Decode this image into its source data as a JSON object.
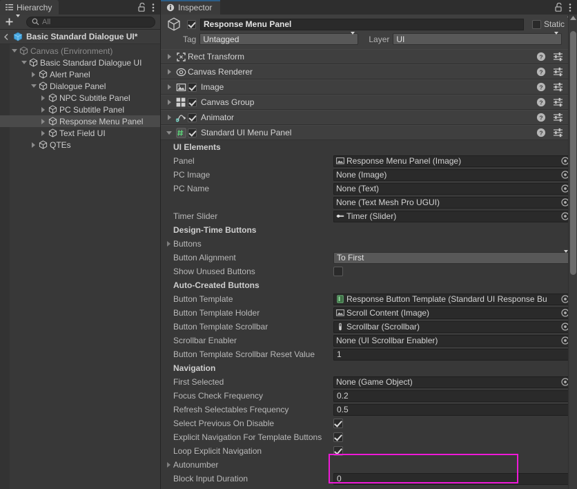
{
  "hierarchy": {
    "tab_label": "Hierarchy",
    "tab_icon": "hierarchy-icon",
    "lock_icon": "lock-open-icon",
    "menu_icon": "kebab-menu-icon",
    "toolbar": {
      "add_label": "+",
      "add_icon": "plus-icon",
      "add_caret_icon": "chevron-down-icon",
      "search_icon": "search-icon",
      "search_placeholder": "All",
      "search_value": ""
    },
    "breadcrumb": {
      "back_icon": "chevron-left-icon",
      "prefab_icon": "prefab-cube-icon",
      "label": "Basic Standard Dialogue UI*"
    },
    "tree": [
      {
        "label": "Canvas (Environment)",
        "depth": 1,
        "expanded": true,
        "selected": false,
        "dim": true
      },
      {
        "label": "Basic Standard Dialogue UI",
        "depth": 2,
        "expanded": true,
        "selected": false,
        "dim": false
      },
      {
        "label": "Alert Panel",
        "depth": 3,
        "expanded": false,
        "selected": false,
        "dim": false
      },
      {
        "label": "Dialogue Panel",
        "depth": 3,
        "expanded": true,
        "selected": false,
        "dim": false
      },
      {
        "label": "NPC Subtitle Panel",
        "depth": 4,
        "expanded": false,
        "selected": false,
        "dim": false
      },
      {
        "label": "PC Subtitle Panel",
        "depth": 4,
        "expanded": false,
        "selected": false,
        "dim": false
      },
      {
        "label": "Response Menu Panel",
        "depth": 4,
        "expanded": false,
        "selected": true,
        "dim": false
      },
      {
        "label": "Text Field UI",
        "depth": 4,
        "expanded": false,
        "selected": false,
        "dim": false
      },
      {
        "label": "QTEs",
        "depth": 3,
        "expanded": false,
        "selected": false,
        "dim": false
      }
    ]
  },
  "inspector": {
    "tab_label": "Inspector",
    "tab_icon": "info-icon",
    "lock_icon": "lock-open-icon",
    "menu_icon": "kebab-menu-icon",
    "object_header": {
      "icon": "gameobject-cube-icon",
      "active_checked": true,
      "name": "Response Menu Panel",
      "static_label": "Static",
      "static_checked": false,
      "static_caret_icon": "chevron-down-icon",
      "tag_label": "Tag",
      "tag_value": "Untagged",
      "layer_label": "Layer",
      "layer_value": "UI"
    },
    "components": [
      {
        "name": "Rect Transform",
        "icon": "rect-transform-icon",
        "expanded": false,
        "has_enable": false,
        "enabled": false
      },
      {
        "name": "Canvas Renderer",
        "icon": "canvas-renderer-icon",
        "expanded": false,
        "has_enable": false,
        "enabled": false
      },
      {
        "name": "Image",
        "icon": "image-icon",
        "expanded": false,
        "has_enable": true,
        "enabled": true
      },
      {
        "name": "Canvas Group",
        "icon": "canvas-group-icon",
        "expanded": false,
        "has_enable": true,
        "enabled": true
      },
      {
        "name": "Animator",
        "icon": "animator-icon",
        "expanded": false,
        "has_enable": true,
        "enabled": true
      },
      {
        "name": "Standard UI Menu Panel",
        "icon": "script-icon",
        "expanded": true,
        "has_enable": true,
        "enabled": true
      }
    ],
    "component_row_icons": {
      "help_icon": "help-circle-icon",
      "preset_icon": "preset-sliders-icon",
      "menu_icon": "kebab-menu-icon"
    },
    "properties": [
      {
        "kind": "section",
        "label": "UI Elements"
      },
      {
        "kind": "object",
        "label": "Panel",
        "value": "Response Menu Panel (Image)",
        "value_icon": "image-asset-icon"
      },
      {
        "kind": "object",
        "label": "PC Image",
        "value": "None (Image)",
        "value_icon": ""
      },
      {
        "kind": "object",
        "label": "PC Name",
        "value": "None (Text)",
        "value_icon": ""
      },
      {
        "kind": "object",
        "label": "",
        "value": "None (Text Mesh Pro UGUI)",
        "value_icon": ""
      },
      {
        "kind": "object",
        "label": "Timer Slider",
        "value": "Timer (Slider)",
        "value_icon": "slider-asset-icon"
      },
      {
        "kind": "section",
        "label": "Design-Time Buttons"
      },
      {
        "kind": "foldout",
        "label": "Buttons",
        "expanded": false
      },
      {
        "kind": "enum",
        "label": "Button Alignment",
        "value": "To First"
      },
      {
        "kind": "check",
        "label": "Show Unused Buttons",
        "checked": false
      },
      {
        "kind": "section",
        "label": "Auto-Created Buttons"
      },
      {
        "kind": "object",
        "label": "Button Template",
        "value": "Response Button Template (Standard UI Response Bu",
        "value_icon": "prefab-asset-icon"
      },
      {
        "kind": "object",
        "label": "Button Template Holder",
        "value": "Scroll Content (Image)",
        "value_icon": "image-asset-icon"
      },
      {
        "kind": "object",
        "label": "Button Template Scrollbar",
        "value": "Scrollbar (Scrollbar)",
        "value_icon": "scrollbar-asset-icon"
      },
      {
        "kind": "object",
        "label": "Scrollbar Enabler",
        "value": "None (UI Scrollbar Enabler)",
        "value_icon": ""
      },
      {
        "kind": "number",
        "label": "Button Template Scrollbar Reset Value",
        "value": "1"
      },
      {
        "kind": "section",
        "label": "Navigation"
      },
      {
        "kind": "object",
        "label": "First Selected",
        "value": "None (Game Object)",
        "value_icon": ""
      },
      {
        "kind": "number",
        "label": "Focus Check Frequency",
        "value": "0.2"
      },
      {
        "kind": "number",
        "label": "Refresh Selectables Frequency",
        "value": "0.5"
      },
      {
        "kind": "check",
        "label": "Select Previous On Disable",
        "checked": true
      },
      {
        "kind": "check",
        "label": "Explicit Navigation For Template Buttons",
        "checked": true
      },
      {
        "kind": "check",
        "label": "Loop Explicit Navigation",
        "checked": true
      },
      {
        "kind": "foldout",
        "label": "Autonumber",
        "expanded": false
      },
      {
        "kind": "number",
        "label": "Block Input Duration",
        "value": "0"
      }
    ],
    "highlight_color": "#ef19d8"
  }
}
